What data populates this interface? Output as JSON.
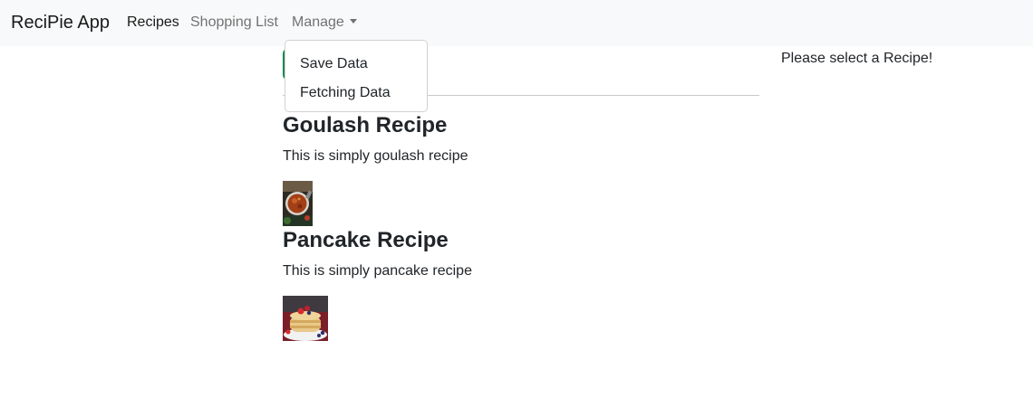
{
  "navbar": {
    "brand": "ReciPie App",
    "links": {
      "recipes": "Recipes",
      "shopping_list": "Shopping List",
      "manage": "Manage"
    }
  },
  "manage_menu": {
    "items": [
      "Save Data",
      "Fetching Data"
    ]
  },
  "recipes": [
    {
      "name": "Goulash Recipe",
      "description": "This is simply goulash recipe",
      "image": "goulash-image"
    },
    {
      "name": "Pancake Recipe",
      "description": "This is simply pancake recipe",
      "image": "pancake-image"
    }
  ],
  "detail": {
    "placeholder": "Please select a Recipe!"
  },
  "colors": {
    "navbar_bg": "#f8f9fa",
    "new_button": "#198754",
    "text": "#212529"
  }
}
